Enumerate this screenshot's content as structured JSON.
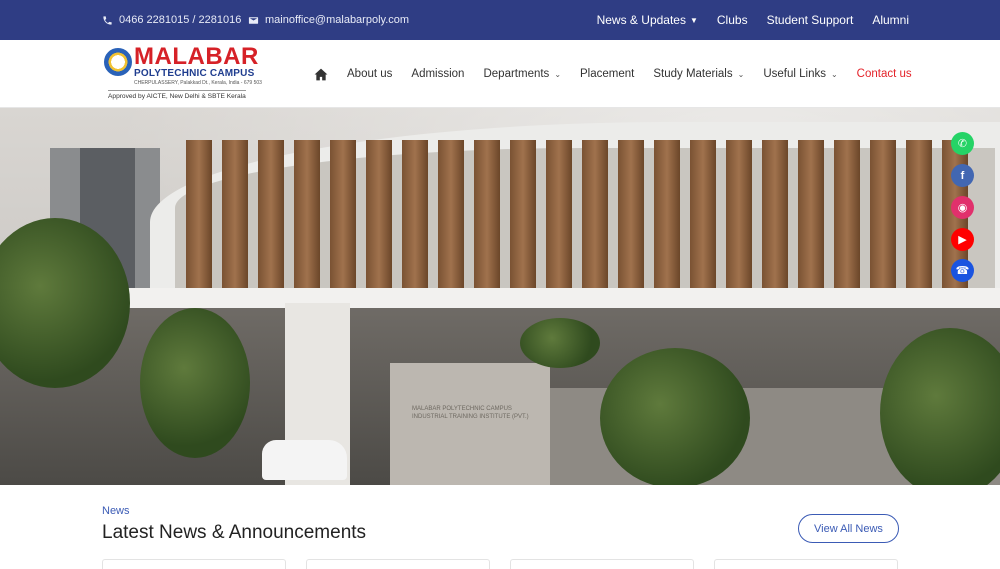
{
  "topbar": {
    "phone": "0466 2281015 / 2281016",
    "email": "mainoffice@malabarpoly.com",
    "nav": [
      {
        "label": "News & Updates",
        "has_dropdown": true
      },
      {
        "label": "Clubs"
      },
      {
        "label": "Student Support"
      },
      {
        "label": "Alumni"
      }
    ],
    "background": "#2f3d84"
  },
  "logo": {
    "name": "MALABAR",
    "subtitle": "POLYTECHNIC CAMPUS",
    "address": "CHERPULASSERY, Palakkad Dt., Kerala, India - 679 503",
    "approval": "Approved by AICTE, New Delhi & SBTE Kerala"
  },
  "mainnav": {
    "items": [
      {
        "label": "About us"
      },
      {
        "label": "Admission"
      },
      {
        "label": "Departments",
        "has_dropdown": true
      },
      {
        "label": "Placement"
      },
      {
        "label": "Study Materials",
        "has_dropdown": true
      },
      {
        "label": "Useful Links",
        "has_dropdown": true
      },
      {
        "label": "Contact us",
        "highlight": true
      }
    ],
    "home_icon": "home-icon",
    "highlight_color": "#e4232a"
  },
  "hero": {
    "sign_text_1": "MALABAR POLYTECHNIC CAMPUS",
    "sign_text_2": "INDUSTRIAL TRAINING INSTITUTE (PVT.)"
  },
  "social": [
    {
      "name": "whatsapp-icon",
      "color": "#25d366"
    },
    {
      "name": "facebook-icon",
      "color": "#4267b2"
    },
    {
      "name": "instagram-icon",
      "color": "#e1306c"
    },
    {
      "name": "youtube-icon",
      "color": "#ff0000"
    },
    {
      "name": "phone-icon",
      "color": "#1a54e0"
    }
  ],
  "news": {
    "tag": "News",
    "title": "Latest News & Announcements",
    "view_all": "View All News"
  }
}
